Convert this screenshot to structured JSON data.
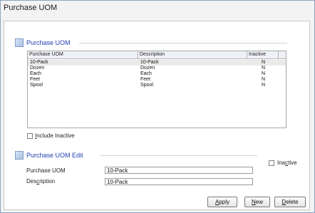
{
  "window": {
    "title": "Purchase UOM"
  },
  "list_section": {
    "title": "Purchase UOM",
    "columns": [
      "Purchase UOM",
      "Description",
      "Inactive"
    ],
    "rows": [
      {
        "uom": "10-Pack",
        "description": "10-Pack",
        "inactive": "N"
      },
      {
        "uom": "Dozen",
        "description": "Dozen",
        "inactive": "N"
      },
      {
        "uom": "Each",
        "description": "Each",
        "inactive": "N"
      },
      {
        "uom": "Feet",
        "description": "Feet",
        "inactive": "N"
      },
      {
        "uom": "Spool",
        "description": "Spool",
        "inactive": "N"
      }
    ],
    "include_inactive": {
      "label_u": "I",
      "label_rest": "nclude Inactive",
      "checked": false
    }
  },
  "edit_section": {
    "title": "Purchase UOM Edit",
    "inactive": {
      "label_pre": "Ina",
      "label_u": "c",
      "label_rest": "tive",
      "checked": false
    },
    "fields": {
      "uom_label": "Purchase UOM",
      "uom_value": "10-Pack",
      "desc_label_pre": "Des",
      "desc_label_u": "c",
      "desc_label_rest": "ription",
      "desc_value": "10-Pack"
    }
  },
  "buttons": {
    "apply": {
      "u": "A",
      "rest": "pply"
    },
    "new": {
      "u": "N",
      "rest": "ew"
    },
    "delete": {
      "u": "D",
      "rest": "elete"
    }
  }
}
